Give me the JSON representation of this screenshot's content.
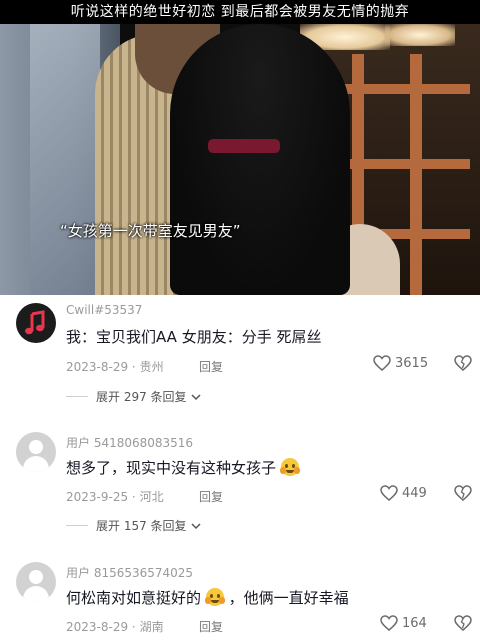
{
  "video": {
    "top_caption": "听说这样的绝世好初恋  到最后都会被男友无情的抛弃",
    "subtitle": "“女孩第一次带室友见男友”"
  },
  "comments": [
    {
      "username": "Cwill#53537",
      "text": "我：宝贝我们AA   女朋友：分手  死屌丝",
      "has_emoji": false,
      "date": "2023-8-29",
      "location": "贵州",
      "reply_label": "回复",
      "likes": "3615",
      "expand_label": "展开 297 条回复",
      "avatar": "music-note-avatar"
    },
    {
      "username": "用户 5418068083516",
      "text": "想多了，现实中没有这种女孩子",
      "text_after": "",
      "has_emoji": true,
      "date": "2023-9-25",
      "location": "河北",
      "reply_label": "回复",
      "likes": "449",
      "expand_label": "展开 157 条回复",
      "avatar": "default-avatar"
    },
    {
      "username": "用户 8156536574025",
      "text": "何松南对如意挺好的",
      "text_after": "，他俩一直好幸福",
      "has_emoji": true,
      "date": "2023-8-29",
      "location": "湖南",
      "reply_label": "回复",
      "likes": "164",
      "avatar": "default-avatar"
    }
  ],
  "icons": {
    "like": "heart-outline-icon",
    "dislike": "broken-heart-icon",
    "expand": "chevron-down-icon"
  }
}
